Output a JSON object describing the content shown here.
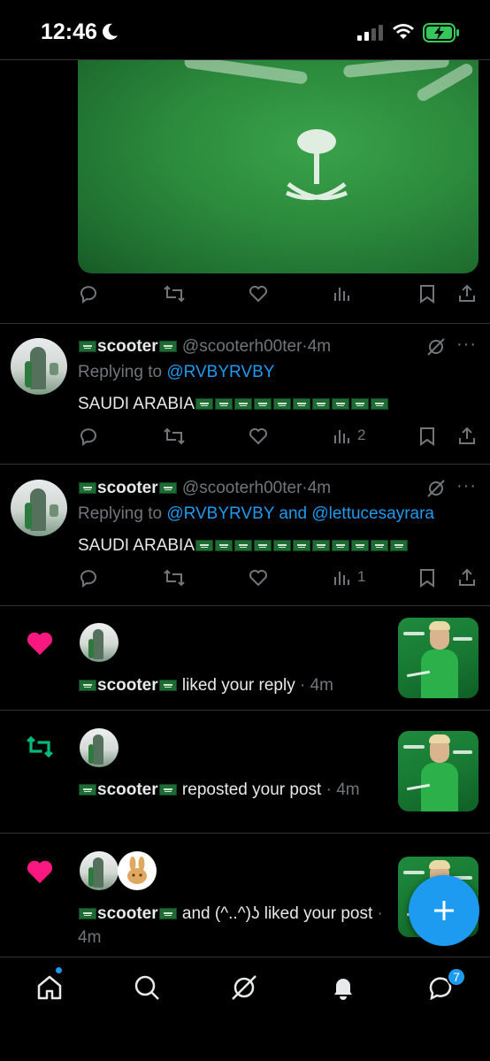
{
  "status_bar": {
    "time": "12:46"
  },
  "media_tweet": {
    "image_alt": "green saudi jersey with emblem"
  },
  "tweets": [
    {
      "name": "scooter",
      "handle": "@scooterh00ter",
      "age": "4m",
      "replying_prefix": "Replying to",
      "mentions": [
        "@RVBYRVBY"
      ],
      "joiner": "",
      "body": "SAUDI ARABIA",
      "body_flags": 10,
      "views": "2"
    },
    {
      "name": "scooter",
      "handle": "@scooterh00ter",
      "age": "4m",
      "replying_prefix": "Replying to",
      "mentions": [
        "@RVBYRVBY",
        "@lettucesayrara"
      ],
      "joiner": "and",
      "body": "SAUDI ARABIA",
      "body_flags": 11,
      "views": "1"
    }
  ],
  "notifications": [
    {
      "type": "like",
      "name": "scooter",
      "action": "liked your reply",
      "age": "4m"
    },
    {
      "type": "repost",
      "name": "scooter",
      "action": "reposted your post",
      "age": "4m"
    },
    {
      "type": "like",
      "name": "scooter",
      "joiner": "and",
      "name2": "(^..^)ʖ",
      "action": "liked your post",
      "age": "4m"
    }
  ],
  "tabs": [
    "home",
    "search",
    "grok",
    "notifications",
    "messages"
  ],
  "messages_badge": "7",
  "colors": {
    "accent": "#1d9bf0",
    "like": "#f91880",
    "repost": "#00ba7c",
    "muted": "#71767b",
    "background": "#000000"
  }
}
